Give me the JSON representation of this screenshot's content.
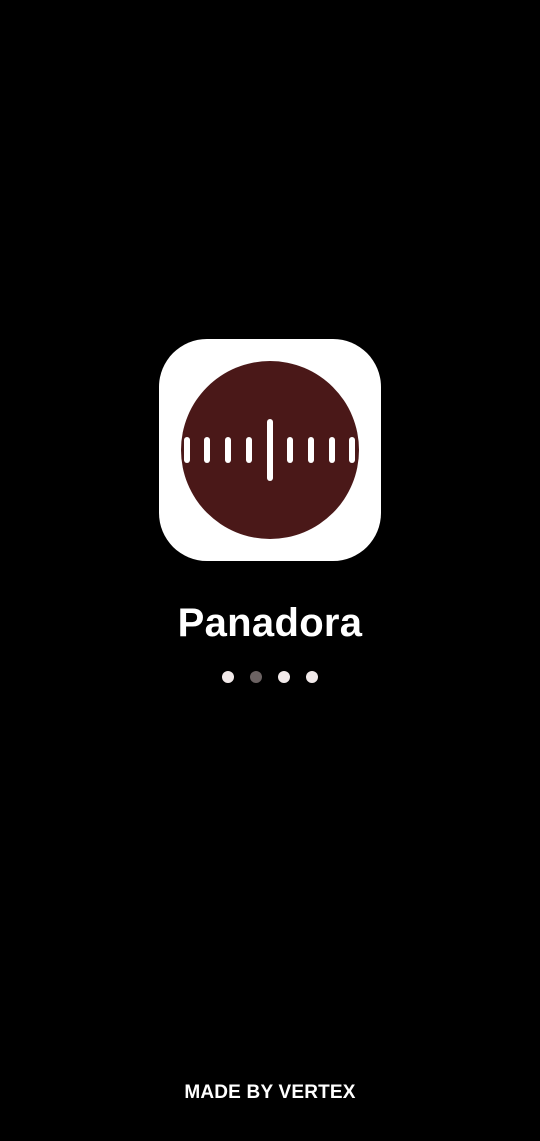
{
  "splash": {
    "app_name": "Panadora",
    "footer_text": "MADE BY VERTEX",
    "icon": "sound-wave-record-icon",
    "loading_dots": {
      "count": 4,
      "active_index": 1
    }
  },
  "colors": {
    "background": "#000000",
    "icon_tile": "#ffffff",
    "icon_disc": "#4a1818",
    "wave_bars": "#ffffff",
    "dot_inactive": "#f2eaea",
    "dot_active": "#6b6262"
  }
}
